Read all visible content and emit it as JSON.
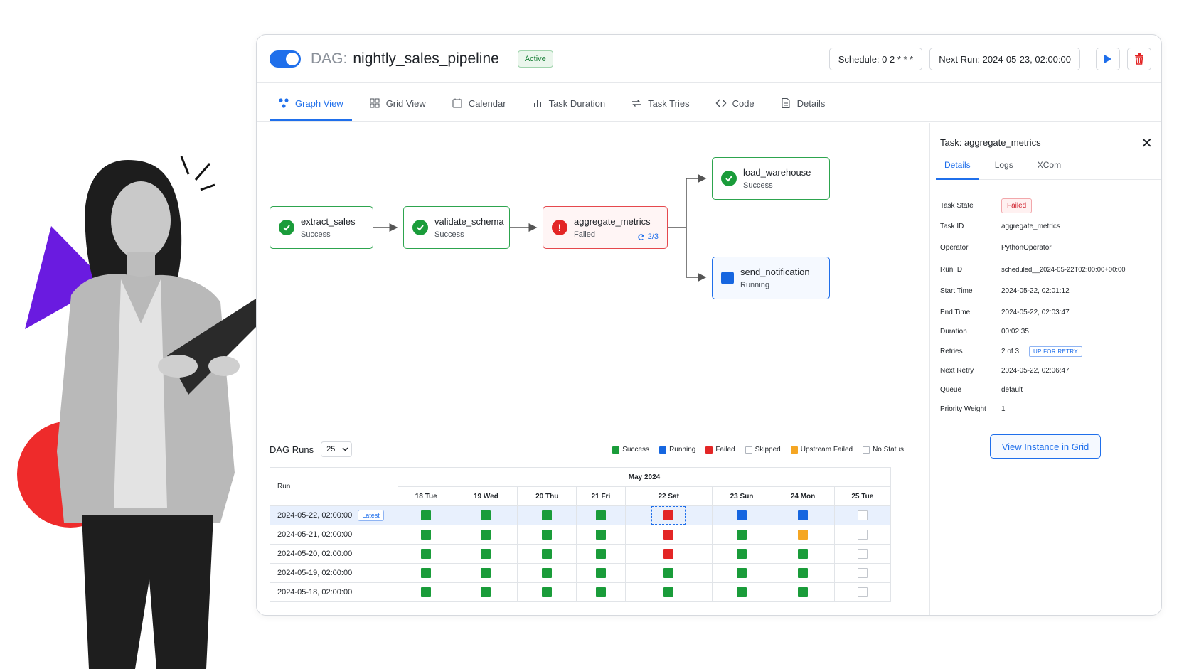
{
  "header": {
    "dag_prefix": "DAG:",
    "dag_name": "nightly_sales_pipeline",
    "status_badge": "Active",
    "schedule": "Schedule: 0 2 * * *",
    "next_run": "Next Run: 2024-05-23, 02:00:00"
  },
  "tabs": [
    {
      "label": "Graph View",
      "icon": "graph-icon"
    },
    {
      "label": "Grid View",
      "icon": "grid-icon"
    },
    {
      "label": "Calendar",
      "icon": "calendar-icon"
    },
    {
      "label": "Task Duration",
      "icon": "bar-chart-icon"
    },
    {
      "label": "Task Tries",
      "icon": "retry-icon"
    },
    {
      "label": "Code",
      "icon": "code-icon"
    },
    {
      "label": "Details",
      "icon": "document-icon"
    }
  ],
  "graph": {
    "nodes": [
      {
        "name": "extract_sales",
        "status": "Success"
      },
      {
        "name": "validate_schema",
        "status": "Success"
      },
      {
        "name": "aggregate_metrics",
        "status": "Failed",
        "tries": "2/3"
      },
      {
        "name": "load_warehouse",
        "status": "Success"
      },
      {
        "name": "send_notification",
        "status": "Running"
      }
    ]
  },
  "runs": {
    "title": "DAG Runs",
    "count": "25",
    "legend": [
      "Success",
      "Running",
      "Failed",
      "Skipped",
      "Upstream Failed",
      "No Status"
    ],
    "month": "May 2024",
    "run_header": "Run",
    "days": [
      "18 Tue",
      "19 Wed",
      "20 Thu",
      "21 Fri",
      "22 Sat",
      "23 Sun",
      "24 Mon",
      "25 Tue"
    ],
    "latest_label": "Latest",
    "rows": [
      {
        "run": "2024-05-22, 02:00:00",
        "cells": [
          "s",
          "s",
          "s",
          "s",
          "f",
          "r",
          "r",
          "n"
        ]
      },
      {
        "run": "2024-05-21, 02:00:00",
        "cells": [
          "s",
          "s",
          "s",
          "s",
          "f",
          "s",
          "u",
          "n"
        ]
      },
      {
        "run": "2024-05-20, 02:00:00",
        "cells": [
          "s",
          "s",
          "s",
          "s",
          "f",
          "s",
          "s",
          "n"
        ]
      },
      {
        "run": "2024-05-19, 02:00:00",
        "cells": [
          "s",
          "s",
          "s",
          "s",
          "s",
          "s",
          "s",
          "n"
        ]
      },
      {
        "run": "2024-05-18, 02:00:00",
        "cells": [
          "s",
          "s",
          "s",
          "s",
          "s",
          "s",
          "s",
          "n"
        ]
      }
    ]
  },
  "colors": {
    "success": "#1a9c3a",
    "running": "#1666e0",
    "failed": "#e32626",
    "upstream_failed": "#f5a623",
    "accent": "#1f6feb"
  },
  "panel": {
    "title": "Task: aggregate_metrics",
    "tabs": [
      "Details",
      "Logs",
      "XCom"
    ],
    "fields": {
      "task_state_label": "Task State",
      "task_state": "Failed",
      "task_id_label": "Task ID",
      "task_id": "aggregate_metrics",
      "operator_label": "Operator",
      "operator": "PythonOperator",
      "run_id_label": "Run ID",
      "run_id": "scheduled__2024-05-22T02:00:00+00:00",
      "start_label": "Start Time",
      "start": "2024-05-22, 02:01:12",
      "end_label": "End Time",
      "end": "2024-05-22, 02:03:47",
      "duration_label": "Duration",
      "duration": "00:02:35",
      "retries_label": "Retries",
      "retries": "2 of 3",
      "retry_badge": "UP FOR RETRY",
      "next_retry_label": "Next Retry",
      "next_retry": "2024-05-22, 02:06:47",
      "queue_label": "Queue",
      "queue": "default",
      "priority_label": "Priority Weight",
      "priority": "1"
    },
    "view_button": "View Instance in Grid"
  }
}
